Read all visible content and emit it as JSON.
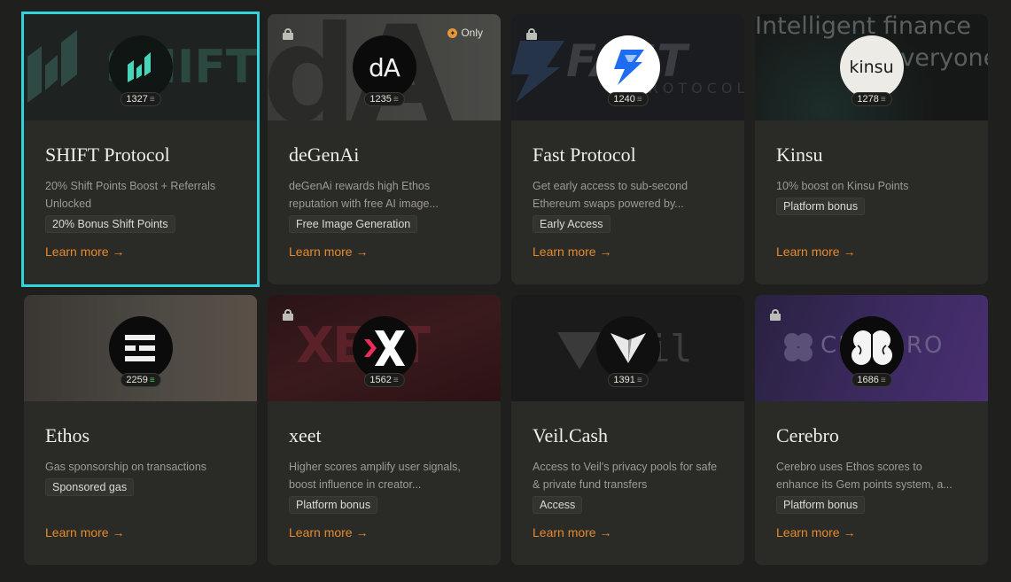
{
  "cards": [
    {
      "title": "SHIFT Protocol",
      "description": "20% Shift Points Boost + Referrals Unlocked",
      "tag": "20% Bonus Shift Points",
      "score": "1327",
      "link": "Learn more →",
      "banner_text": "SHIFT",
      "avatar_text": "",
      "icon": "shift-logo-icon",
      "locked": false,
      "selected": true
    },
    {
      "title": "deGenAi",
      "description": "deGenAi rewards high Ethos reputation with free AI image...",
      "tag": "Free Image Generation",
      "score": "1235",
      "link": "Learn more →",
      "banner_text": "dA",
      "avatar_text": "dA",
      "badge": "Only",
      "icon": "degenai-logo-icon",
      "locked": true
    },
    {
      "title": "Fast Protocol",
      "description": "Get early access to sub-second Ethereum swaps powered by...",
      "tag": "Early Access",
      "score": "1240",
      "link": "Learn more →",
      "banner_text": "FAST",
      "banner_sub": "PROTOCOL",
      "avatar_text": "",
      "icon": "lightning-bolt-icon",
      "locked": true
    },
    {
      "title": "Kinsu",
      "description": "10% boost on Kinsu Points",
      "tag": "Platform bonus",
      "score": "1278",
      "link": "Learn more →",
      "banner_text": "Intelligent finance",
      "banner_sub": "for everyone",
      "avatar_text": "kinsu",
      "icon": "kinsu-logo-icon",
      "locked": false
    },
    {
      "title": "Ethos",
      "description": "Gas sponsorship on transactions",
      "tag": "Sponsored gas",
      "score": "2259",
      "link": "Learn more →",
      "avatar_text": "",
      "icon": "ethos-logo-icon",
      "locked": false
    },
    {
      "title": "xeet",
      "description": "Higher scores amplify user signals, boost influence in creator...",
      "tag": "Platform bonus",
      "score": "1562",
      "link": "Learn more →",
      "banner_text": "XEET",
      "avatar_text": "X",
      "icon": "xeet-logo-icon",
      "locked": true
    },
    {
      "title": "Veil.Cash",
      "description": "Access to Veil's privacy pools for safe & private fund transfers",
      "tag": "Access",
      "score": "1391",
      "link": "Learn more →",
      "banner_text": "il",
      "avatar_text": "",
      "icon": "veil-logo-icon",
      "locked": false
    },
    {
      "title": "Cerebro",
      "description": "Cerebro uses Ethos scores to enhance its Gem points system, a...",
      "tag": "Platform bonus",
      "score": "1686",
      "link": "Learn more →",
      "banner_text": "CEREBRO",
      "avatar_text": "",
      "icon": "brain-icon",
      "locked": true
    }
  ],
  "colors": {
    "accent_link": "#e58a2f",
    "selected_outline": "#32d3dc",
    "background": "#1f1f1d",
    "card": "#2a2a27"
  }
}
